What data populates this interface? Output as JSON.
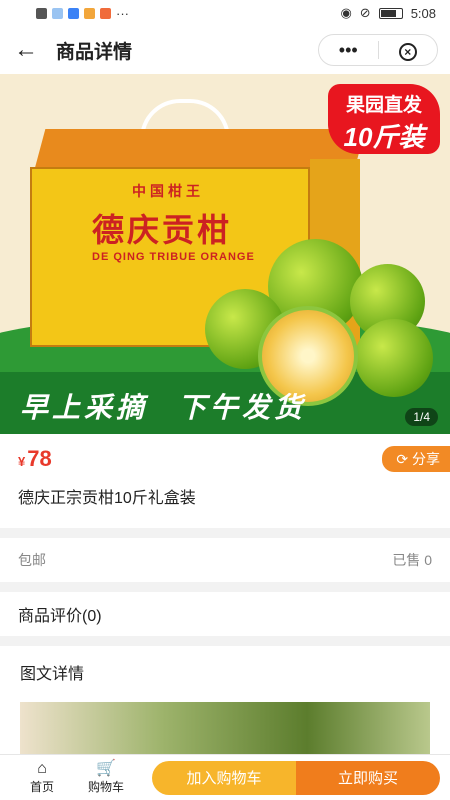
{
  "status_bar": {
    "time": "5:08",
    "dots": "···"
  },
  "header": {
    "title": "商品详情",
    "more_label": "•••",
    "close_label": "×"
  },
  "banner": {
    "badge_line1": "果园直发",
    "badge_line2": "10斤装",
    "box_small": "中国柑王",
    "box_big": "德庆贡柑",
    "box_en": "DE QING TRIBUE ORANGE",
    "slogan_left": "早上采摘",
    "slogan_right": "下午发货",
    "pager": "1/4"
  },
  "product": {
    "currency": "¥",
    "price": "78",
    "share_label": "分享",
    "name": "德庆正宗贡柑10斤礼盒装"
  },
  "shipping": {
    "label": "包邮",
    "sold": "已售 0"
  },
  "reviews": {
    "label": "商品评价(0)"
  },
  "detail": {
    "label": "图文详情"
  },
  "tabbar": {
    "home_label": "首页",
    "cart_label": "购物车",
    "add_cart_label": "加入购物车",
    "buy_now_label": "立即购买"
  },
  "colors": {
    "price": "#e8392b",
    "share": "#f28a25",
    "add_cart": "#f7b52b",
    "buy_now": "#f07d1c",
    "banner_green": "#1c7d2a"
  }
}
